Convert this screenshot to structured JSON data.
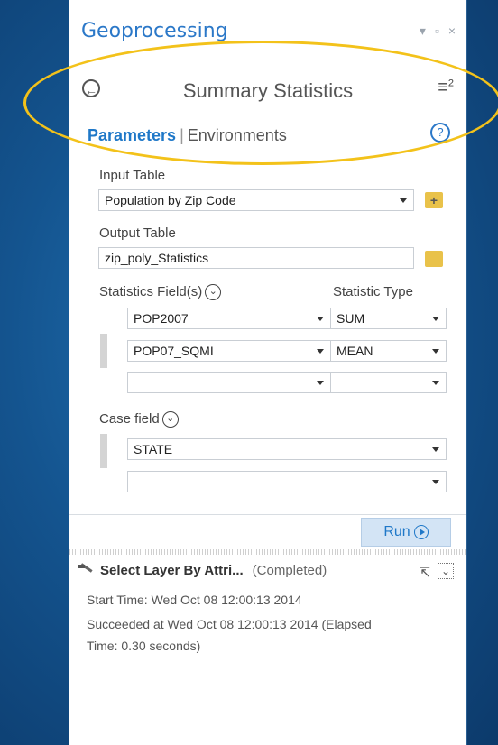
{
  "window": {
    "title": "Geoprocessing",
    "controls": [
      "▾",
      "▫",
      "×"
    ]
  },
  "tool": {
    "title": "Summary Statistics"
  },
  "tabs": [
    {
      "label": "Parameters",
      "active": true
    },
    {
      "label": "Environments",
      "active": false
    }
  ],
  "params": {
    "input_table_label": "Input Table",
    "input_table_value": "Population by Zip Code",
    "output_table_label": "Output Table",
    "output_table_value": "zip_poly_Statistics",
    "stats_fields_label": "Statistics Field(s)",
    "stat_type_label": "Statistic Type",
    "stats_rows": [
      {
        "field": "POP2007",
        "type": "SUM"
      },
      {
        "field": "POP07_SQMI",
        "type": "MEAN"
      },
      {
        "field": "",
        "type": ""
      }
    ],
    "case_field_label": "Case field",
    "case_rows": [
      {
        "field": "STATE"
      },
      {
        "field": ""
      }
    ]
  },
  "run_label": "Run",
  "messages": {
    "tool_name": "Select Layer By Attri...",
    "status": "(Completed)",
    "lines": [
      "Start Time: Wed Oct 08 12:00:13 2014",
      "Succeeded at Wed Oct 08 12:00:13 2014 (Elapsed",
      "Time: 0.30 seconds)"
    ]
  },
  "colors": {
    "accent": "#1f78c8",
    "highlight": "#f3c21a",
    "background": "#14548f"
  }
}
